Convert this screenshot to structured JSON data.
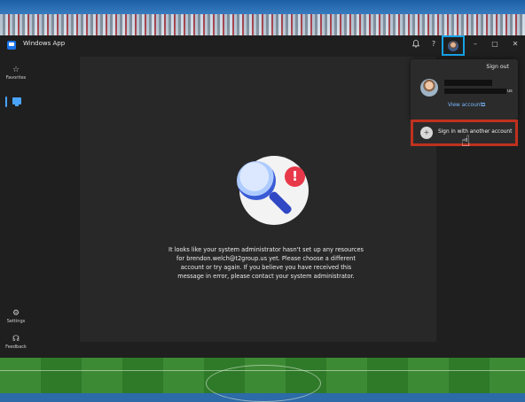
{
  "app": {
    "title": "Windows App",
    "icon": "windows-app-logo"
  },
  "titlebar": {
    "notifications_icon": "bell-icon",
    "help_label": "?",
    "minimize_label": "–",
    "maximize_label": "▢",
    "close_label": "✕",
    "account_button": "avatar-icon"
  },
  "sidebar": {
    "items": [
      {
        "label": "Favorites",
        "icon": "star-icon"
      },
      {
        "label": "",
        "icon": "devices-icon"
      },
      {
        "label": "Settings",
        "icon": "gear-icon"
      },
      {
        "label": "Feedback",
        "icon": "feedback-icon"
      }
    ]
  },
  "main": {
    "message": "It looks like your system administrator hasn't set up any resources for brendon.welch@t2group.us yet. Please choose a different account or try again. If you believe you have received this message in error, please contact your system administrator.",
    "illustration": "magnifier-alert-icon"
  },
  "account_menu": {
    "sign_out_label": "Sign out",
    "email_suffix": "us",
    "view_account_label": "View account",
    "view_account_icon": "external-link-icon",
    "sign_in_another_label": "Sign in with another account",
    "sign_in_another_icon": "add-user-icon"
  },
  "colors": {
    "accent": "#4aa3ff",
    "highlight_box_account": "#16a2e8",
    "highlight_box_signin": "#c0311f",
    "alert": "#e8394a"
  }
}
